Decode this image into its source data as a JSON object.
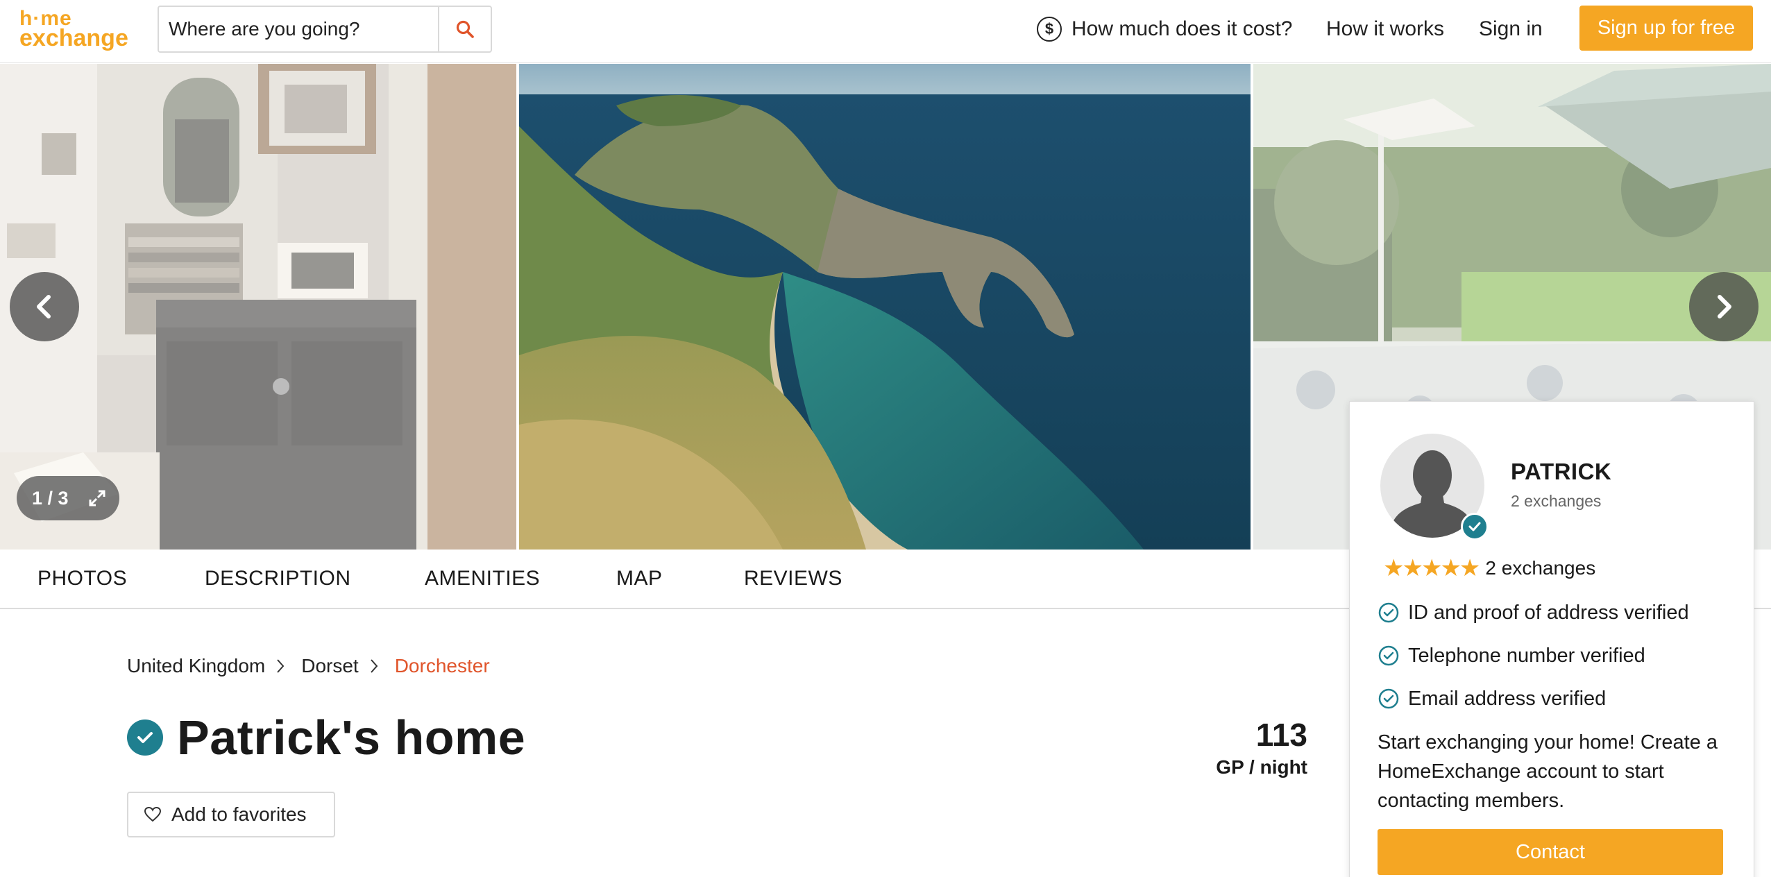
{
  "header": {
    "logo_line1": "h·me",
    "logo_line2": "exchange",
    "search_placeholder": "Where are you going?",
    "nav": {
      "cost": "How much does it cost?",
      "how_it_works": "How it works",
      "sign_in": "Sign in",
      "sign_up": "Sign up for free"
    },
    "icons": {
      "search": "search-icon",
      "cost": "dollar-circle-icon"
    },
    "accent_color": "#f5a623"
  },
  "gallery": {
    "counter": "1 / 3",
    "icons": {
      "prev": "chevron-left-icon",
      "next": "chevron-right-icon",
      "fullscreen": "expand-icon"
    }
  },
  "tabs": [
    "PHOTOS",
    "DESCRIPTION",
    "AMENITIES",
    "MAP",
    "REVIEWS"
  ],
  "breadcrumb": {
    "country": "United Kingdom",
    "region": "Dorset",
    "city": "Dorchester"
  },
  "listing": {
    "title": "Patrick's home",
    "price": "113",
    "price_unit": "GP / night",
    "favorite_label": "Add to favorites"
  },
  "host": {
    "name": "PATRICK",
    "exchanges": "2 exchanges",
    "rating_exchanges": "2 exchanges",
    "stars": "★★★★★",
    "verifications": [
      "ID and proof of address verified",
      "Telephone number verified",
      "Email address verified"
    ],
    "cta_text": "Start exchanging your home! Create a HomeExchange account to start contacting members.",
    "contact_label": "Contact",
    "verified_color": "#1f7f8f"
  }
}
